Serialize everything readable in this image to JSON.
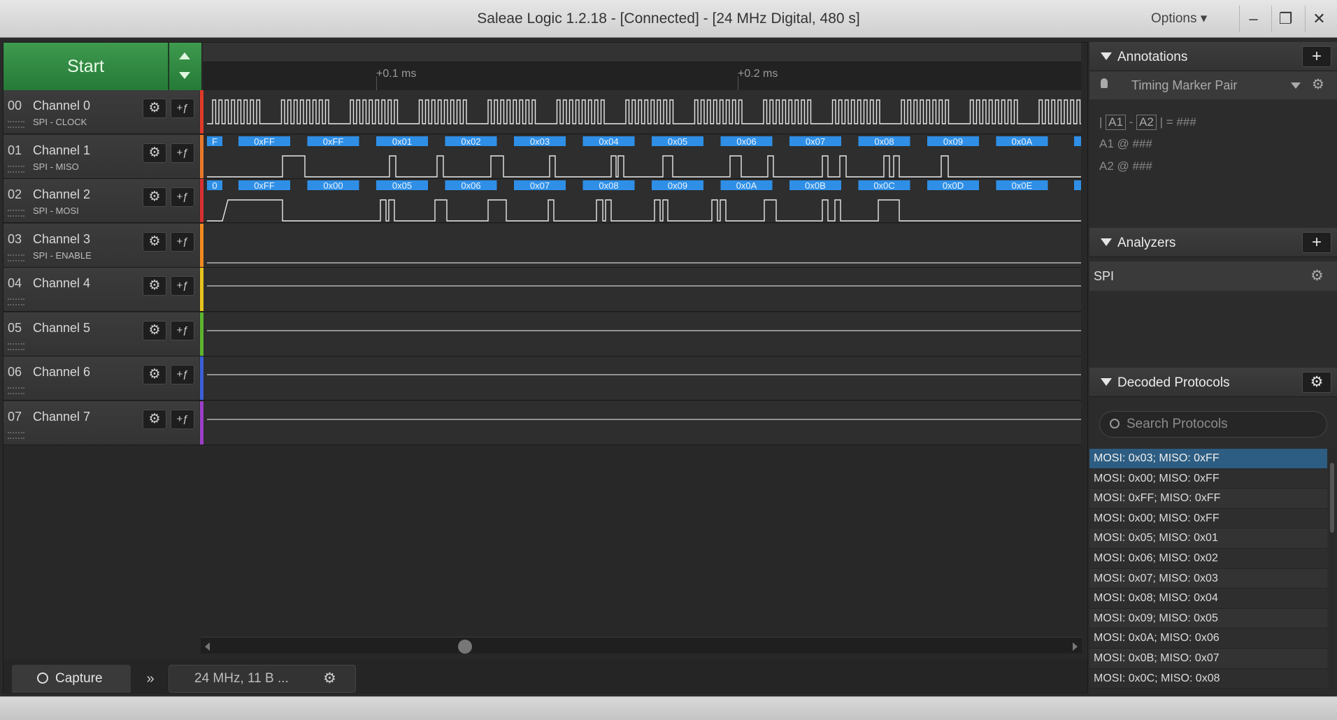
{
  "window": {
    "title": "Saleae Logic 1.2.18 - [Connected] - [24 MHz Digital, 480 s]",
    "options_label": "Options ▾",
    "min_glyph": "–",
    "restore_glyph": "❐",
    "close_glyph": "✕"
  },
  "start": {
    "label": "Start"
  },
  "ruler": {
    "ticks": [
      "+0.1 ms",
      "+0.2 ms"
    ]
  },
  "channels": [
    {
      "num": "00",
      "name": "Channel 0",
      "sub": "SPI - CLOCK",
      "color": "#e03a2a"
    },
    {
      "num": "01",
      "name": "Channel 1",
      "sub": "SPI - MISO",
      "color": "#e8782a"
    },
    {
      "num": "02",
      "name": "Channel 2",
      "sub": "SPI - MOSI",
      "color": "#d83030"
    },
    {
      "num": "03",
      "name": "Channel 3",
      "sub": "SPI - ENABLE",
      "color": "#f08a20"
    },
    {
      "num": "04",
      "name": "Channel 4",
      "sub": "",
      "color": "#e6c21e"
    },
    {
      "num": "05",
      "name": "Channel 5",
      "sub": "",
      "color": "#5cb32e"
    },
    {
      "num": "06",
      "name": "Channel 6",
      "sub": "",
      "color": "#3a5fd6"
    },
    {
      "num": "07",
      "name": "Channel 7",
      "sub": "",
      "color": "#9a3ec8"
    }
  ],
  "channel_icons": {
    "gear": "⚙",
    "trigger": "+ƒ"
  },
  "miso_bytes": [
    "F",
    "0xFF",
    "0xFF",
    "0x01",
    "0x02",
    "0x03",
    "0x04",
    "0x05",
    "0x06",
    "0x07",
    "0x08",
    "0x09",
    "0x0A"
  ],
  "mosi_bytes": [
    "0",
    "0xFF",
    "0x00",
    "0x05",
    "0x06",
    "0x07",
    "0x08",
    "0x09",
    "0x0A",
    "0x0B",
    "0x0C",
    "0x0D",
    "0x0E"
  ],
  "bottom": {
    "capture_label": "Capture",
    "chevron": "»",
    "session_label": "24 MHz, 11 B ...",
    "gear": "⚙"
  },
  "annotations": {
    "title": "Annotations",
    "add": "+",
    "marker_label": "Timing Marker Pair",
    "gear": "⚙",
    "line1_a1": "A1",
    "line1_dash": "-",
    "line1_a2": "A2",
    "line1_eq": "| = ###",
    "line2": "A1  @  ###",
    "line3": "A2  @  ###"
  },
  "analyzers": {
    "title": "Analyzers",
    "add": "+",
    "items": [
      {
        "name": "SPI"
      }
    ],
    "gear": "⚙"
  },
  "decoded": {
    "title": "Decoded Protocols",
    "gear": "⚙",
    "search_placeholder": "Search Protocols",
    "rows": [
      "MOSI: 0x03;  MISO: 0xFF",
      "MOSI: 0x00;  MISO: 0xFF",
      "MOSI: 0xFF;  MISO: 0xFF",
      "MOSI: 0x00;  MISO: 0xFF",
      "MOSI: 0x05;  MISO: 0x01",
      "MOSI: 0x06;  MISO: 0x02",
      "MOSI: 0x07;  MISO: 0x03",
      "MOSI: 0x08;  MISO: 0x04",
      "MOSI: 0x09;  MISO: 0x05",
      "MOSI: 0x0A;  MISO: 0x06",
      "MOSI: 0x0B;  MISO: 0x07",
      "MOSI: 0x0C;  MISO: 0x08"
    ]
  }
}
